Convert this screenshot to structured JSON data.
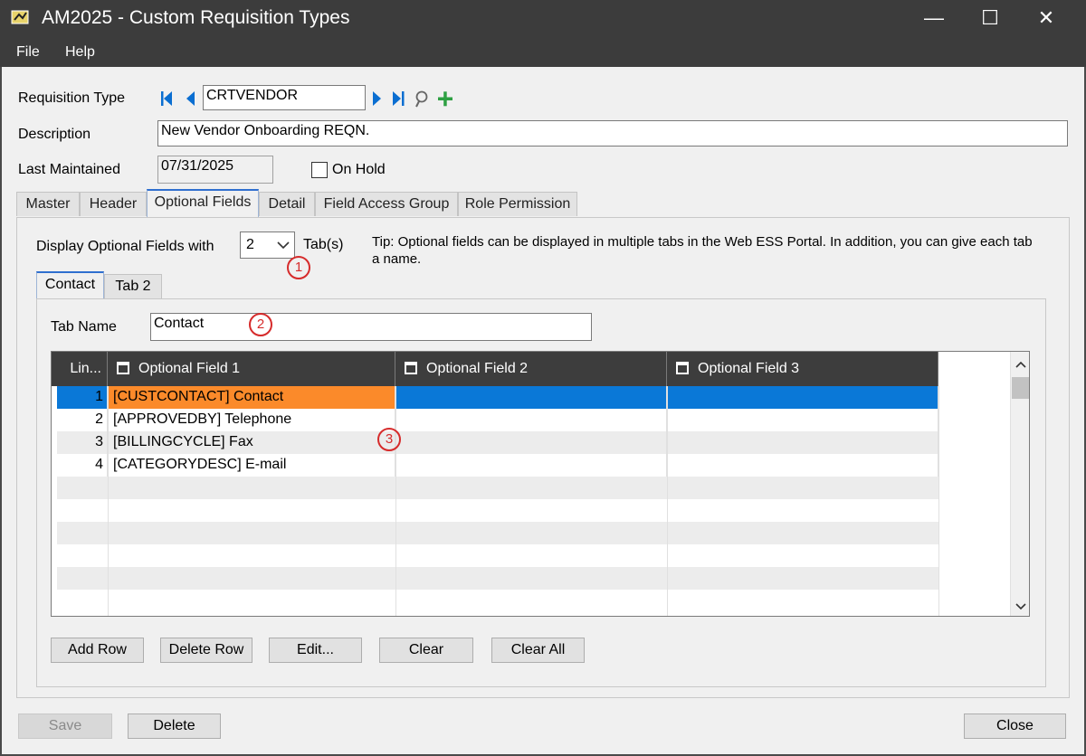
{
  "window": {
    "title": "AM2025 - Custom Requisition Types",
    "controls": {
      "minimize": "—",
      "maximize": "☐",
      "close": "✕"
    }
  },
  "menu": {
    "file": "File",
    "help": "Help"
  },
  "form": {
    "requisition_type_label": "Requisition Type",
    "requisition_type_value": "CRTVENDOR",
    "description_label": "Description",
    "description_value": "New Vendor Onboarding REQN.",
    "last_maintained_label": "Last Maintained",
    "last_maintained_value": "07/31/2025",
    "on_hold_label": "On Hold",
    "on_hold_checked": false
  },
  "tabs": [
    "Master",
    "Header",
    "Optional Fields",
    "Detail",
    "Field Access Group",
    "Role Permission"
  ],
  "active_tab": "Optional Fields",
  "optional_fields": {
    "display_label": "Display Optional Fields with",
    "tabs_count": "2",
    "tabs_suffix": "Tab(s)",
    "tip": "Tip: Optional fields can be displayed in multiple tabs in the Web ESS Portal. In addition, you can give each tab a name.",
    "subtabs": [
      "Contact",
      "Tab 2"
    ],
    "tab_name_label": "Tab Name",
    "tab_name_value": "Contact",
    "annotations": [
      "1",
      "2",
      "3"
    ]
  },
  "grid": {
    "columns": [
      "Lin...",
      "Optional Field 1",
      "Optional Field 2",
      "Optional Field 3"
    ],
    "rows": [
      {
        "line": "1",
        "f1": "[CUSTCONTACT] Contact",
        "f2": "",
        "f3": ""
      },
      {
        "line": "2",
        "f1": "[APPROVEDBY] Telephone",
        "f2": "",
        "f3": ""
      },
      {
        "line": "3",
        "f1": "[BILLINGCYCLE] Fax",
        "f2": "",
        "f3": ""
      },
      {
        "line": "4",
        "f1": "[CATEGORYDESC] E-mail",
        "f2": "",
        "f3": ""
      }
    ]
  },
  "buttons": {
    "add_row": "Add Row",
    "delete_row": "Delete Row",
    "edit": "Edit...",
    "clear": "Clear",
    "clear_all": "Clear All",
    "save": "Save",
    "delete": "Delete",
    "close": "Close"
  },
  "colors": {
    "selected_row": "#0a78d7",
    "selected_cell": "#fb8a2a",
    "nav_arrow": "#0a6ed1",
    "add_icon": "#2ea043",
    "annotation": "#d62b2b"
  }
}
